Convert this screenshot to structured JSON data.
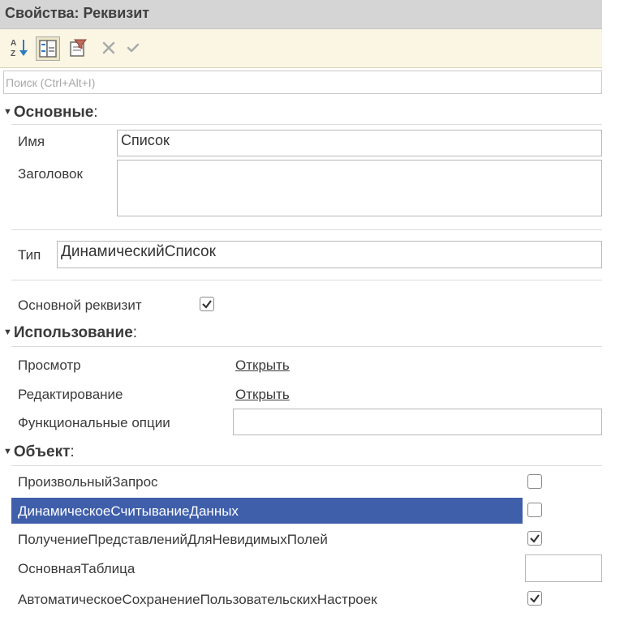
{
  "window": {
    "title": "Свойства: Реквизит"
  },
  "search": {
    "placeholder": "Поиск (Ctrl+Alt+I)"
  },
  "toolbar": {
    "buttons": [
      {
        "icon": "sort-alphabetical-icon"
      },
      {
        "icon": "categories-icon"
      },
      {
        "icon": "filter-icon"
      },
      {
        "icon": "close-icon"
      },
      {
        "icon": "checkmark-icon"
      }
    ]
  },
  "sections": {
    "main": {
      "title": "Основные",
      "name_label": "Имя",
      "name_value": "Список",
      "header_label": "Заголовок",
      "header_value": "",
      "type_label": "Тип",
      "type_value": "ДинамическийСписок",
      "main_attr_label": "Основной реквизит",
      "main_attr_checked": true
    },
    "usage": {
      "title": "Использование",
      "view_label": "Просмотр",
      "view_link": "Открыть",
      "edit_label": "Редактирование",
      "edit_link": "Открыть",
      "options_label": "Функциональные опции",
      "options_value": ""
    },
    "object": {
      "title": "Объект",
      "rows": [
        {
          "label": "ПроизвольныйЗапрос",
          "checked": false
        },
        {
          "label": "ДинамическоеСчитываниеДанных",
          "checked": false,
          "selected": true
        },
        {
          "label": "ПолучениеПредставленийДляНевидимыхПолей",
          "checked": true
        },
        {
          "label": "ОсновнаяТаблица",
          "value": ""
        },
        {
          "label": "АвтоматическоеСохранениеПользовательскихНастроек",
          "checked": true
        }
      ]
    }
  },
  "colors": {
    "title_bar": "#d5d5d5",
    "toolbar": "#faf6e3",
    "selection": "#3f5fab",
    "selection_text": "#ffffff"
  }
}
